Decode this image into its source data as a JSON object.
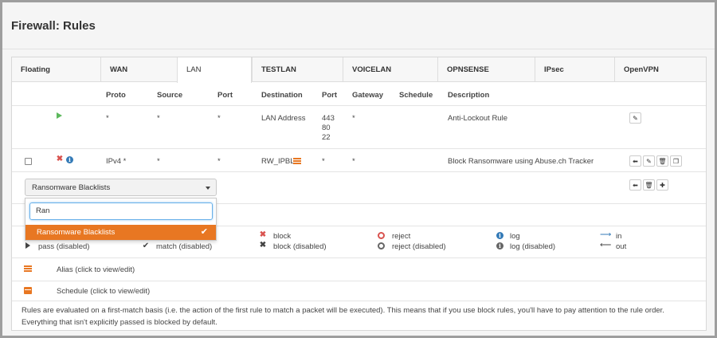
{
  "page": {
    "title": "Firewall: Rules"
  },
  "tabs": [
    "Floating",
    "WAN",
    "LAN",
    "TESTLAN",
    "VOICELAN",
    "OPNSENSE",
    "IPsec",
    "OpenVPN"
  ],
  "active_tab": "LAN",
  "columns": {
    "proto": "Proto",
    "source": "Source",
    "port": "Port",
    "destination": "Destination",
    "dport": "Port",
    "gateway": "Gateway",
    "schedule": "Schedule",
    "description": "Description"
  },
  "rules": [
    {
      "proto": "*",
      "source": "*",
      "port": "*",
      "destination": "LAN Address",
      "dport_lines": [
        "443",
        "80",
        "22"
      ],
      "gateway": "*",
      "description": "Anti-Lockout Rule"
    },
    {
      "proto": "IPv4 *",
      "source": "*",
      "port": "*",
      "destination": "RW_IPBL",
      "dport": "*",
      "gateway": "*",
      "description": "Block Ransomware using Abuse.ch Tracker"
    }
  ],
  "category_select": {
    "selected": "Ransomware Blacklists",
    "search_value": "Ran",
    "option": "Ransomware Blacklists"
  },
  "legend": {
    "pass_disabled": "pass (disabled)",
    "match_disabled": "match (disabled)",
    "block": "block",
    "block_disabled": "block (disabled)",
    "reject": "reject",
    "reject_disabled": "reject (disabled)",
    "log": "log",
    "log_disabled": "log (disabled)",
    "in": "in",
    "out": "out",
    "alias": "Alias (click to view/edit)",
    "schedule": "Schedule (click to view/edit)"
  },
  "footer": "Rules are evaluated on a first-match basis (i.e. the action of the first rule to match a packet will be executed). This means that if you use block rules, you'll have to pay attention to the rule order. Everything that isn't explicitly passed is blocked by default.",
  "colors": {
    "accent": "#e87722",
    "pass": "#5cb85c",
    "block": "#d9534f",
    "info": "#337ab7"
  },
  "icons": [
    "play-icon",
    "close-icon",
    "info-icon",
    "list-icon",
    "pencil-icon",
    "arrow-left-icon",
    "trash-icon",
    "copy-icon",
    "plus-icon",
    "check-icon",
    "calendar-icon"
  ]
}
